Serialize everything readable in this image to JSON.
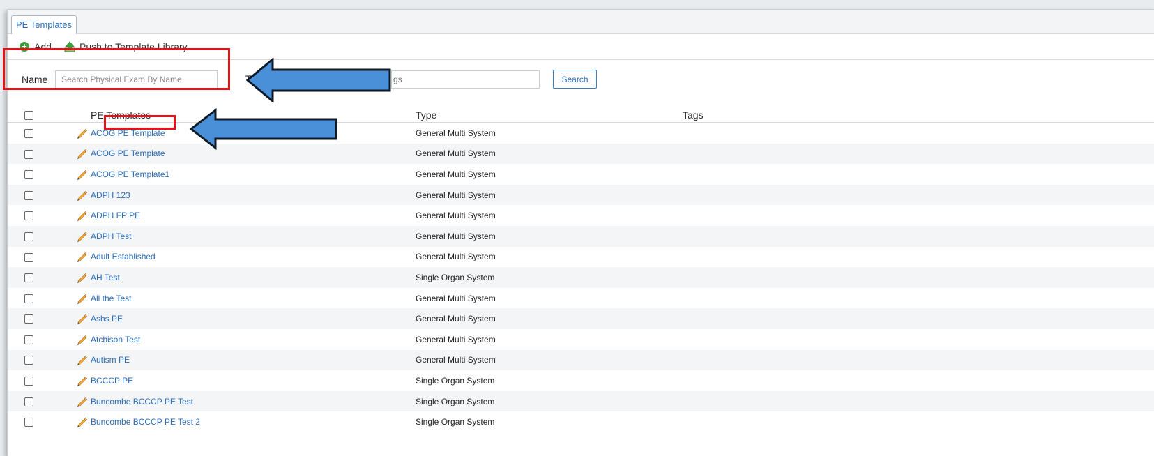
{
  "tab": {
    "label": "PE Templates"
  },
  "toolbar": {
    "add_label": "Add",
    "push_label": "Push to Template Library"
  },
  "search": {
    "name_label": "Name",
    "name_placeholder": "Search Physical Exam By Name",
    "tags_label_visible": "T",
    "tags_placeholder_visible": "gs",
    "button_label": "Search"
  },
  "grid": {
    "columns": [
      "PE Templates",
      "Type",
      "Tags"
    ],
    "rows": [
      {
        "name": "ACOG PE Template",
        "type": "General Multi System",
        "tags": ""
      },
      {
        "name": "ACOG PE Template",
        "type": "General Multi System",
        "tags": ""
      },
      {
        "name": "ACOG PE Template1",
        "type": "General Multi System",
        "tags": ""
      },
      {
        "name": "ADPH 123",
        "type": "General Multi System",
        "tags": ""
      },
      {
        "name": "ADPH FP PE",
        "type": "General Multi System",
        "tags": ""
      },
      {
        "name": "ADPH Test",
        "type": "General Multi System",
        "tags": ""
      },
      {
        "name": "Adult Established",
        "type": "General Multi System",
        "tags": ""
      },
      {
        "name": "AH Test",
        "type": "Single Organ System",
        "tags": ""
      },
      {
        "name": "All the Test",
        "type": "General Multi System",
        "tags": ""
      },
      {
        "name": "Ashs PE",
        "type": "General Multi System",
        "tags": ""
      },
      {
        "name": "Atchison Test",
        "type": "General Multi System",
        "tags": ""
      },
      {
        "name": "Autism PE",
        "type": "General Multi System",
        "tags": ""
      },
      {
        "name": "BCCCP PE",
        "type": "Single Organ System",
        "tags": ""
      },
      {
        "name": "Buncombe BCCCP PE Test",
        "type": "Single Organ System",
        "tags": ""
      },
      {
        "name": "Buncombe BCCCP PE Test 2",
        "type": "Single Organ System",
        "tags": ""
      }
    ]
  },
  "colors": {
    "link": "#2a6ebb",
    "highlight": "#e3131a",
    "arrow_fill": "#4a90d9",
    "add_icon": "#3a9f3a"
  },
  "icons": {
    "add": "plus-circle-icon",
    "push": "upload-icon",
    "row": "pencil-icon",
    "annotation": "arrow-left-icon"
  }
}
